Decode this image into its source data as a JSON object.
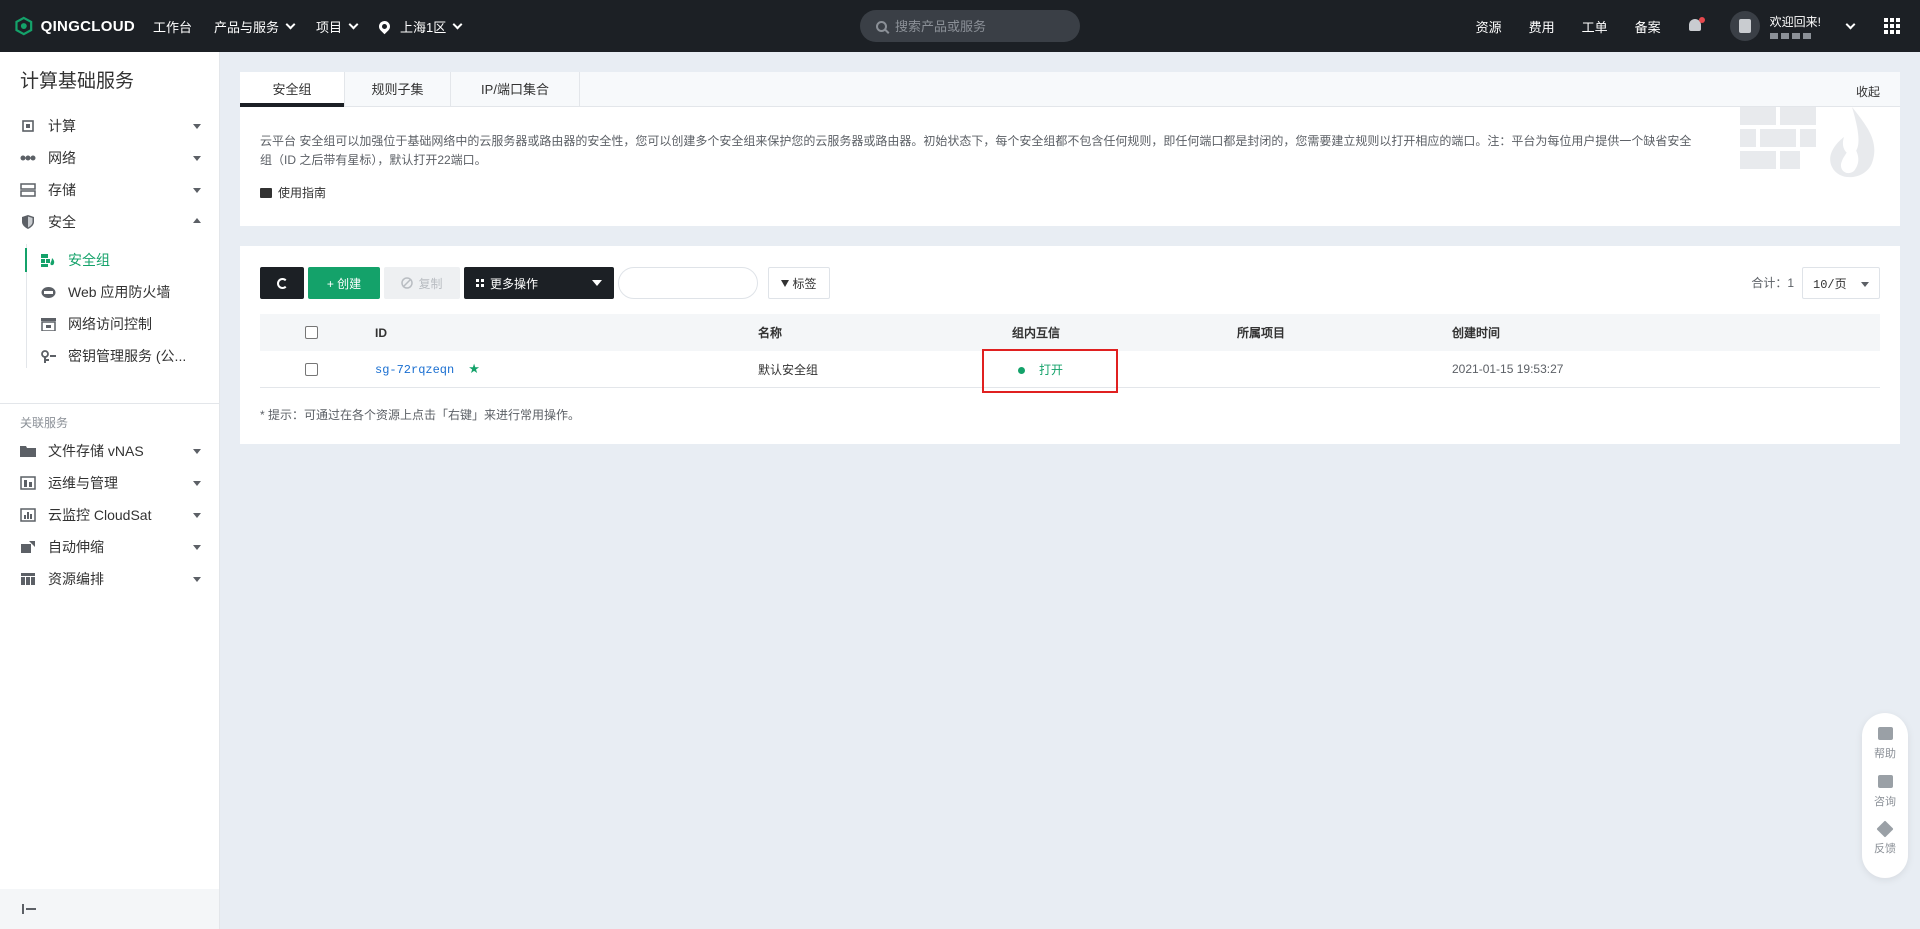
{
  "topbar": {
    "logo": "QINGCLOUD",
    "nav": [
      "工作台",
      "产品与服务",
      "项目",
      "上海1区"
    ],
    "search_placeholder": "搜索产品或服务",
    "right_links": [
      "资源",
      "费用",
      "工单",
      "备案"
    ],
    "welcome": "欢迎回来!"
  },
  "sidebar": {
    "title": "计算基础服务",
    "items": [
      {
        "label": "计算"
      },
      {
        "label": "网络"
      },
      {
        "label": "存储"
      },
      {
        "label": "安全"
      }
    ],
    "security_sub": [
      {
        "label": "安全组"
      },
      {
        "label": "Web 应用防火墙"
      },
      {
        "label": "网络访问控制"
      },
      {
        "label": "密钥管理服务 (公..."
      }
    ],
    "related_title": "关联服务",
    "related": [
      {
        "label": "文件存储 vNAS"
      },
      {
        "label": "运维与管理"
      },
      {
        "label": "云监控 CloudSat"
      },
      {
        "label": "自动伸缩"
      },
      {
        "label": "资源编排"
      }
    ]
  },
  "info": {
    "tabs": [
      "安全组",
      "规则子集",
      "IP/端口集合"
    ],
    "collapse": "收起",
    "description": "云平台 安全组可以加强位于基础网络中的云服务器或路由器的安全性，您可以创建多个安全组来保护您的云服务器或路由器。初始状态下，每个安全组都不包含任何规则，即任何端口都是封闭的，您需要建立规则以打开相应的端口。注：平台为每位用户提供一个缺省安全组（ID 之后带有星标），默认打开22端口。",
    "guide": "使用指南"
  },
  "toolbar": {
    "create": "+ 创建",
    "copy": "复制",
    "more": "更多操作",
    "tag": "标签",
    "total": "合计：1",
    "page_size": "10/页"
  },
  "table": {
    "headers": [
      "ID",
      "名称",
      "组内互信",
      "所属项目",
      "创建时间"
    ],
    "rows": [
      {
        "id": "sg-72rqzeqn",
        "star": "★",
        "name": "默认安全组",
        "inner_trust": "打开",
        "project": "",
        "created": "2021-01-15 19:53:27"
      }
    ],
    "tip": "* 提示：可通过在各个资源上点击「右键」来进行常用操作。"
  },
  "float": [
    "帮助",
    "咨询",
    "反馈"
  ],
  "colors": {
    "accent": "#14a26a",
    "topbar": "#1c2025",
    "highlight": "#e02020",
    "link": "#1a6fd1"
  }
}
